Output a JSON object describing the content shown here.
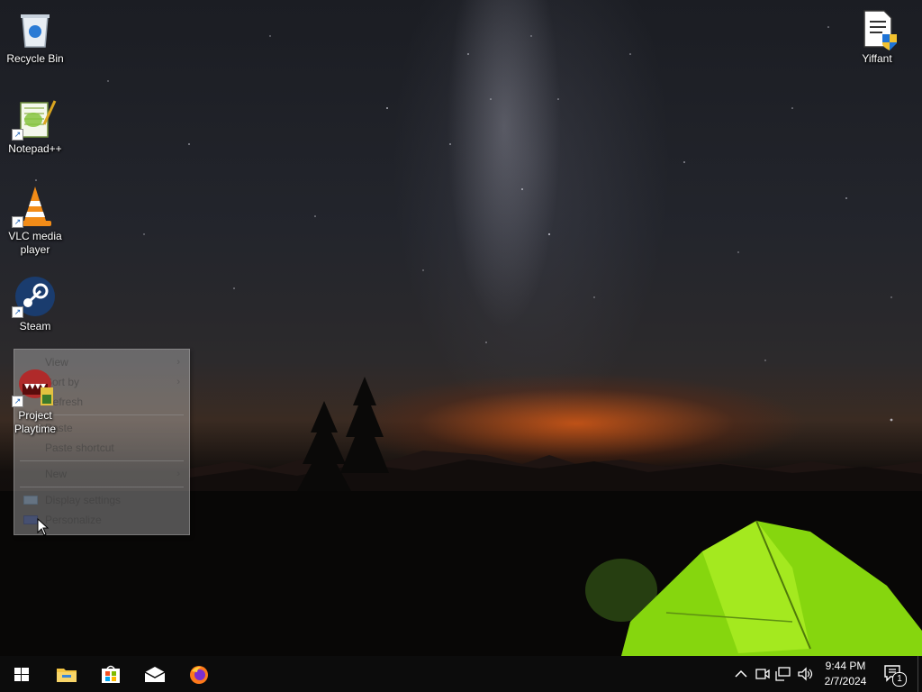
{
  "desktop": {
    "icons": {
      "recycle_bin": "Recycle Bin",
      "yiffant": "Yiffant",
      "notepadpp": "Notepad++",
      "vlc": "VLC media player",
      "steam": "Steam",
      "project_playtime": "Project Playtime"
    }
  },
  "context_menu": {
    "view": "View",
    "sort_by": "Sort by",
    "refresh": "Refresh",
    "paste": "Paste",
    "paste_shortcut": "Paste shortcut",
    "new": "New",
    "display_settings": "Display settings",
    "personalize": "Personalize"
  },
  "taskbar": {
    "pinned": [
      "start-icon",
      "file-explorer-icon",
      "microsoft-store-icon",
      "mail-icon",
      "firefox-icon"
    ],
    "tray": [
      "chevron-up-icon",
      "meet-now-icon",
      "network-icon",
      "volume-icon"
    ],
    "time": "9:44 PM",
    "date": "2/7/2024",
    "notification_count": "1"
  }
}
